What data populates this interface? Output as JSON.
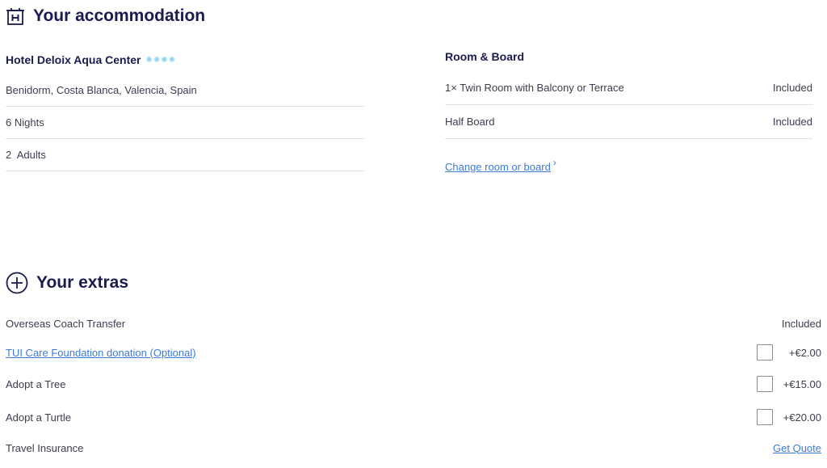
{
  "accommodation": {
    "section_title": "Your accommodation",
    "icon": "hotel-icon",
    "hotel_name": "Hotel Deloix Aqua Center",
    "star_rating": 4,
    "star_color": "#8fd3f4",
    "details": [
      "Benidorm, Costa Blanca, Valencia, Spain",
      "6 Nights",
      "2  Adults"
    ]
  },
  "room_board": {
    "title": "Room & Board",
    "rows": [
      {
        "label": "1× Twin Room with Balcony or Terrace",
        "status": "Included"
      },
      {
        "label": "Half Board",
        "status": "Included"
      }
    ],
    "change_link": "Change room or board",
    "change_link_chevron": "›"
  },
  "extras": {
    "section_title": "Your extras",
    "icon": "plus-circle-icon",
    "items": [
      {
        "label": "Overseas Coach Transfer",
        "value": "Included"
      },
      {
        "label": "TUI Care Foundation donation (Optional)",
        "price": "+€2.00",
        "checked": false
      },
      {
        "label": "Adopt a Tree",
        "price": "+€15.00",
        "checked": false
      },
      {
        "label": "Adopt a Turtle",
        "price": "+€20.00",
        "checked": false
      },
      {
        "label": "Travel Insurance",
        "link": "Get Quote"
      }
    ]
  },
  "colors": {
    "navy": "#1b1b4f",
    "link": "#3d7bd4",
    "divider": "#e1e1e6"
  }
}
